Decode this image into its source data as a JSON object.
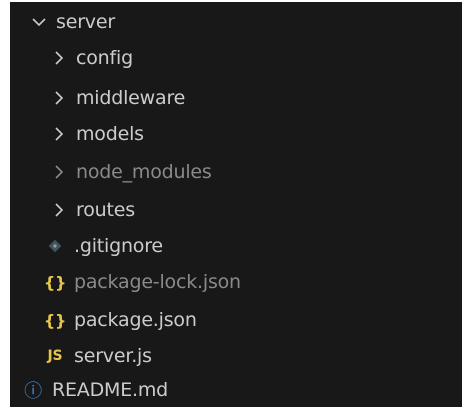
{
  "root": {
    "label": "server",
    "expanded": true
  },
  "folders": [
    {
      "label": "config",
      "dimmed": false
    },
    {
      "label": "middleware",
      "dimmed": false
    },
    {
      "label": "models",
      "dimmed": false
    },
    {
      "label": "node_modules",
      "dimmed": true
    },
    {
      "label": "routes",
      "dimmed": false
    }
  ],
  "files": [
    {
      "label": ".gitignore",
      "icon": "git-diamond-icon",
      "icon_color": "#41535b",
      "dimmed": false
    },
    {
      "label": "package-lock.json",
      "icon": "json-braces-icon",
      "icon_glyph": "{}",
      "icon_color": "#e6c54a",
      "dimmed": true
    },
    {
      "label": "package.json",
      "icon": "json-braces-icon",
      "icon_glyph": "{}",
      "icon_color": "#e6c54a",
      "dimmed": false
    },
    {
      "label": "server.js",
      "icon": "javascript-icon",
      "icon_glyph": "JS",
      "icon_color": "#e6c54a",
      "dimmed": false
    }
  ],
  "outside": {
    "label": "README.md",
    "icon": "info-icon",
    "icon_glyph": "ⓘ",
    "icon_color": "#3f8fd6"
  },
  "colors": {
    "background": "#181818",
    "text": "#cccccc",
    "dimmed_text": "#8a8a8a"
  }
}
